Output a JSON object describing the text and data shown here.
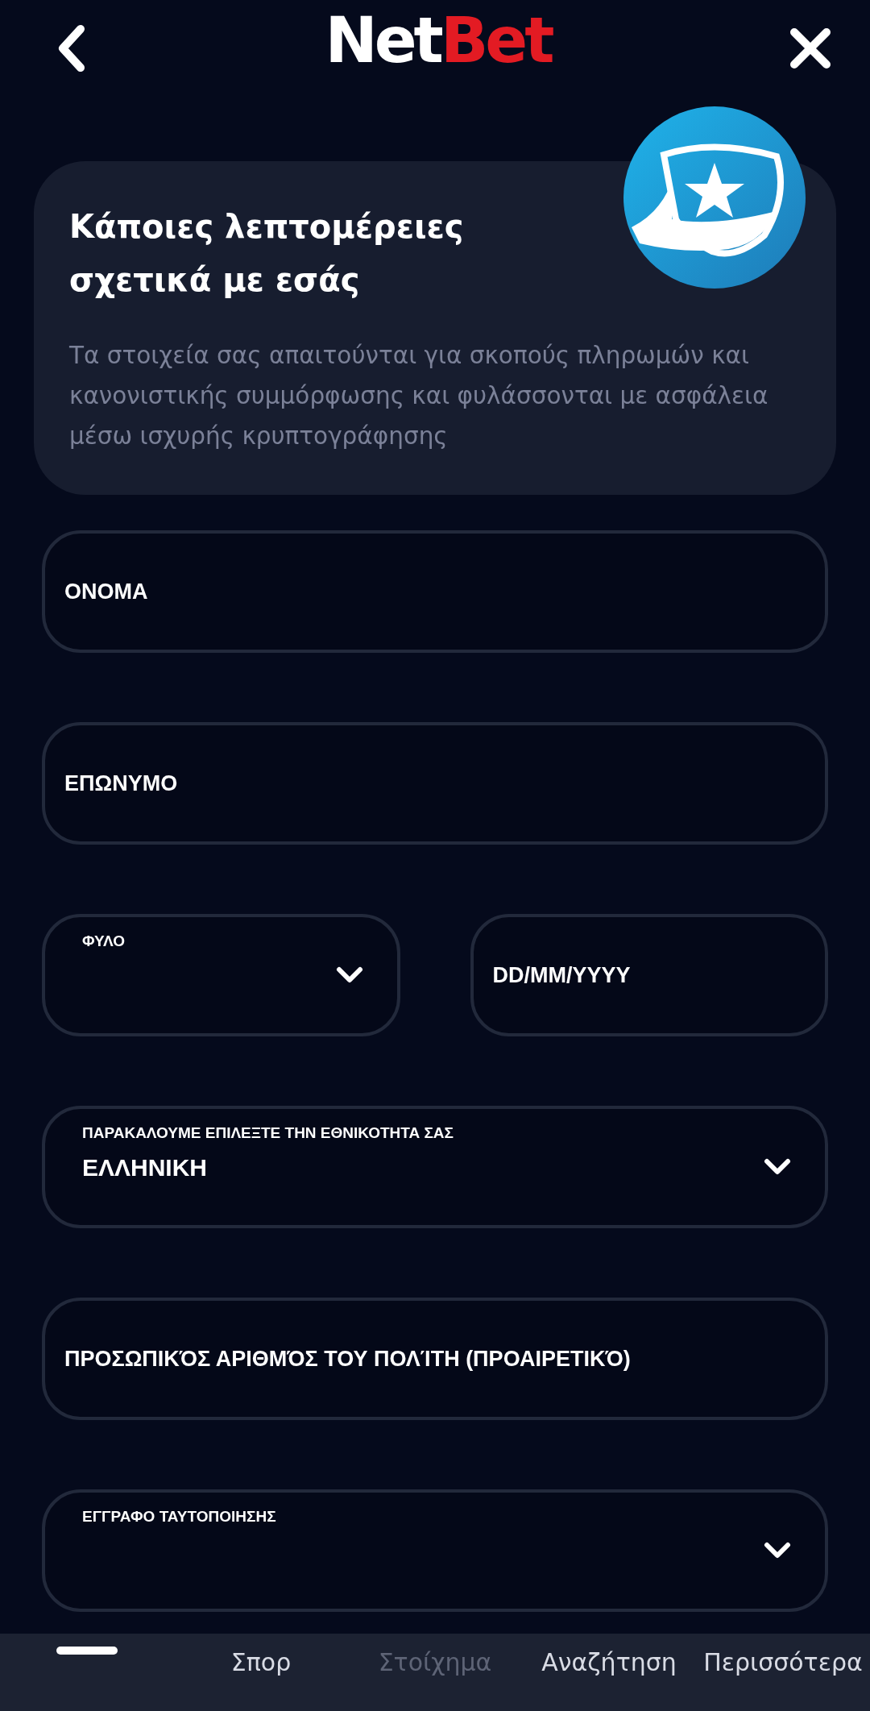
{
  "header": {
    "logo": {
      "part_1": "Net",
      "part_2": "Bet"
    }
  },
  "intro": {
    "title": "Κάποιες λεπτομέρειες σχετικά με εσάς",
    "body": "Τα στοιχεία σας απαιτούνται για σκοπούς πληρωμών και κανονιστικής συμμόρφωσης και φυλάσσονται με ασφάλεια μέσω ισχυρής κρυπτογράφησης"
  },
  "form_rows": [
    [
      {
        "kind": "text",
        "placeholder": "ΟΝΟΜΑ"
      }
    ],
    [
      {
        "kind": "text",
        "placeholder": "ΕΠΩΝΥΜΟ"
      }
    ],
    [
      {
        "kind": "select",
        "label": "ΦΥΛΟ"
      },
      {
        "kind": "text",
        "placeholder": "DD/MM/YYYY"
      }
    ],
    [
      {
        "kind": "select",
        "label": "ΠΑΡΑΚΑΛΟΥΜΕ ΕΠΙΛΕΞΤΕ ΤΗΝ ΕΘΝΙΚΟΤΗΤΑ ΣΑΣ",
        "value": "ΕΛΛΗΝΙΚΗ"
      }
    ],
    [
      {
        "kind": "text",
        "placeholder": "ΠΡΟΣΩΠΙΚΌΣ ΑΡΙΘΜΌΣ ΤΟΥ ΠΟΛΊΤΗ (ΠΡΟΑΙΡΕΤΙΚΌ)"
      }
    ],
    [
      {
        "kind": "select",
        "label": "ΕΓΓΡΑΦΟ ΤΑΥΤΟΠΟΙΗΣΗΣ"
      }
    ]
  ],
  "bottom_nav": [
    {
      "label": "Σπορ",
      "disabled": false
    },
    {
      "label": "Στοίχημα",
      "disabled": true
    },
    {
      "label": "Αναζήτηση",
      "disabled": false
    },
    {
      "label": "Περισσότερα",
      "disabled": false
    }
  ]
}
